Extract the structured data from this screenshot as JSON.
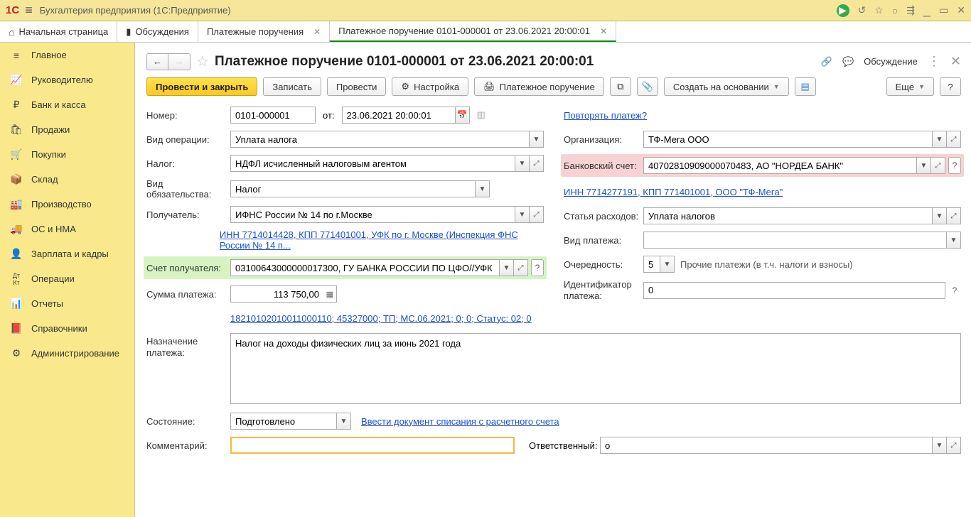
{
  "app": {
    "title": "Бухгалтерия предприятия  (1С:Предприятие)"
  },
  "tabs": {
    "home": "Начальная страница",
    "discuss": "Обсуждения",
    "t1": "Платежные поручения",
    "t2": "Платежное поручение 0101-000001 от 23.06.2021 20:00:01"
  },
  "sidebar": [
    {
      "label": "Главное",
      "icon": "≡"
    },
    {
      "label": "Руководителю",
      "icon": "📈"
    },
    {
      "label": "Банк и касса",
      "icon": "₽"
    },
    {
      "label": "Продажи",
      "icon": "🛍"
    },
    {
      "label": "Покупки",
      "icon": "🛒"
    },
    {
      "label": "Склад",
      "icon": "📦"
    },
    {
      "label": "Производство",
      "icon": "🏭"
    },
    {
      "label": "ОС и НМА",
      "icon": "🚚"
    },
    {
      "label": "Зарплата и кадры",
      "icon": "👤"
    },
    {
      "label": "Операции",
      "icon": "Дт/Кт"
    },
    {
      "label": "Отчеты",
      "icon": "📊"
    },
    {
      "label": "Справочники",
      "icon": "📕"
    },
    {
      "label": "Администрирование",
      "icon": "⚙"
    }
  ],
  "doc": {
    "title": "Платежное поручение 0101-000001 от 23.06.2021 20:00:01",
    "discuss_btn": "Обсуждение"
  },
  "toolbar": {
    "post_close": "Провести и закрыть",
    "write": "Записать",
    "post": "Провести",
    "settings": "Настройка",
    "print": "Платежное поручение",
    "create_based": "Создать на основании",
    "more": "Еще"
  },
  "form": {
    "number_lbl": "Номер:",
    "number": "0101-000001",
    "date_lbl": "от:",
    "date": "23.06.2021 20:00:01",
    "repeat_link": "Повторять платеж?",
    "op_type_lbl": "Вид операции:",
    "op_type": "Уплата налога",
    "org_lbl": "Организация:",
    "org": "ТФ-Мега ООО",
    "tax_lbl": "Налог:",
    "tax": "НДФЛ исчисленный налоговым агентом",
    "bank_acc_lbl": "Банковский счет:",
    "bank_acc": "40702810909000070483, АО \"НОРДЕА БАНК\"",
    "bank_link": "ИНН 7714277191, КПП 771401001, ООО \"ТФ-Мега\"",
    "oblig_lbl": "Вид обязательства:",
    "oblig": "Налог",
    "recip_lbl": "Получатель:",
    "recip": "ИФНС России № 14 по г.Москве",
    "recip_link": "ИНН 7714014428, КПП 771401001, УФК по г. Москве (Инспекция ФНС России № 14 п...",
    "exp_item_lbl": "Статья расходов:",
    "exp_item": "Уплата налогов",
    "pay_type_lbl": "Вид платежа:",
    "pay_type": "",
    "recip_acc_lbl": "Счет получателя:",
    "recip_acc": "03100643000000017300, ГУ БАНКА РОССИИ ПО ЦФО//УФК",
    "priority_lbl": "Очередность:",
    "priority": "5",
    "priority_note": "Прочие платежи (в т.ч. налоги и взносы)",
    "sum_lbl": "Сумма платежа:",
    "sum": "113 750,00",
    "ident_lbl": "Идентификатор платежа:",
    "ident": "0",
    "kbk_link": "18210102010011000110; 45327000; ТП; МС.06.2021; 0; 0; Статус: 02; 0",
    "purpose_lbl": "Назначение платежа:",
    "purpose": "Налог на доходы физических лиц за июнь 2021 года",
    "state_lbl": "Состояние:",
    "state": "Подготовлено",
    "state_link": "Ввести документ списания с расчетного счета",
    "comment_lbl": "Комментарий:",
    "comment": "",
    "resp_lbl": "Ответственный:",
    "resp": "о"
  }
}
